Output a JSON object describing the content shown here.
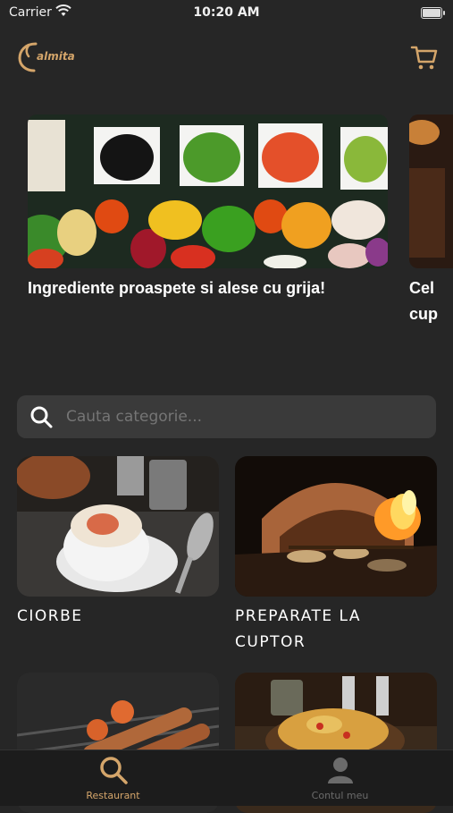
{
  "status": {
    "carrier": "Carrier",
    "time": "10:20 AM"
  },
  "header": {
    "logo_text": "almita",
    "logo_icon": "logo-icon",
    "cart_icon": "cart-icon"
  },
  "colors": {
    "accent": "#d4a56a",
    "background": "#262626",
    "tab_active": "#d4a56a",
    "tab_inactive": "#6b6b6b"
  },
  "carousel": {
    "slides": [
      {
        "caption": "Ingrediente proaspete si alese cu grija!"
      },
      {
        "caption": "Cel\ncup"
      }
    ]
  },
  "search": {
    "placeholder": "Cauta categorie...",
    "icon": "search-icon"
  },
  "categories": [
    {
      "title": "CIORBE"
    },
    {
      "title": "PREPARATE LA CUPTOR"
    },
    {
      "title": ""
    },
    {
      "title": ""
    }
  ],
  "tabs": [
    {
      "label": "Restaurant",
      "icon": "search-icon",
      "active": true
    },
    {
      "label": "Contul meu",
      "icon": "user-icon",
      "active": false
    }
  ]
}
